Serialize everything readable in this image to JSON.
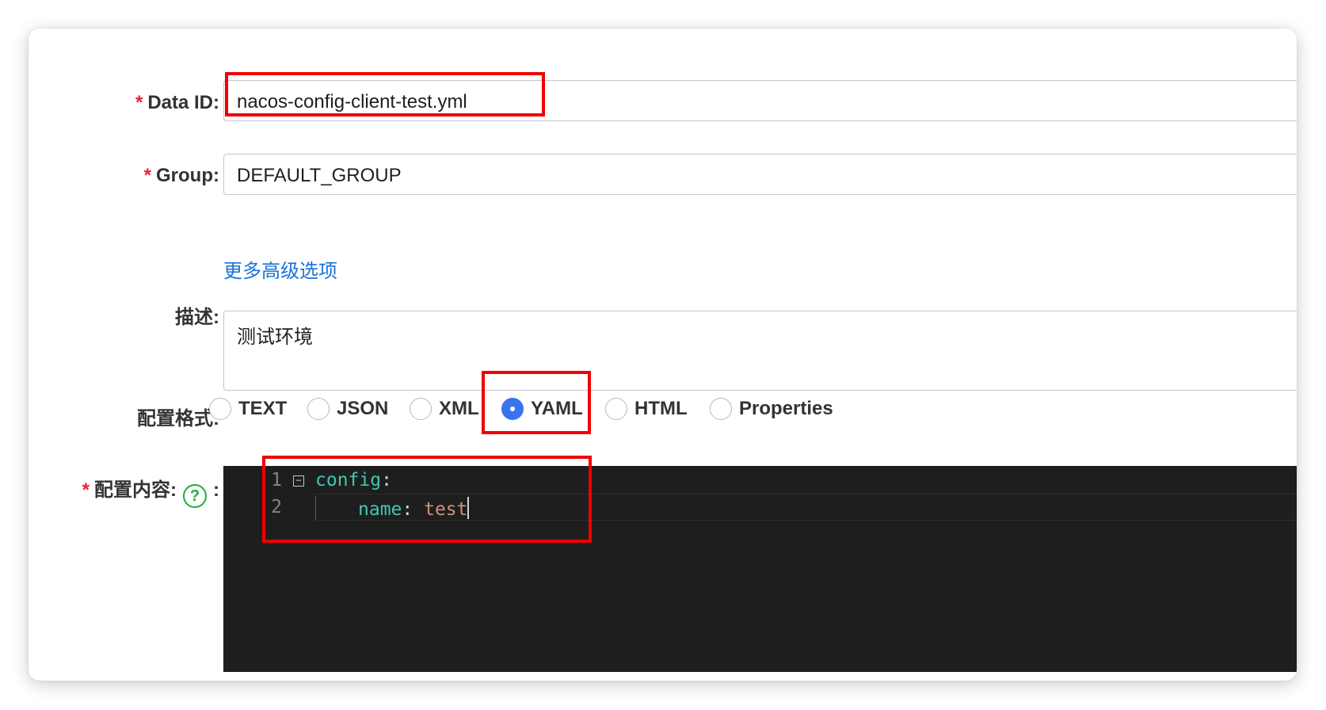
{
  "form": {
    "data_id": {
      "label": "Data ID:",
      "value": "nacos-config-client-test.yml"
    },
    "group": {
      "label": "Group:",
      "value": "DEFAULT_GROUP"
    },
    "advanced_link": "更多高级选项",
    "description": {
      "label": "描述:",
      "value": "测试环境"
    },
    "format": {
      "label": "配置格式:",
      "options": [
        "TEXT",
        "JSON",
        "XML",
        "YAML",
        "HTML",
        "Properties"
      ],
      "selected": "YAML"
    },
    "content": {
      "label": "配置内容:",
      "help": "?",
      "colon": ":",
      "line_numbers": [
        "1",
        "2"
      ],
      "line1_key": "config",
      "line1_colon": ":",
      "line2_key": "name",
      "line2_colon": ": ",
      "line2_value": "test"
    },
    "required_marker": "*"
  },
  "colors": {
    "accent": "#3a73f0",
    "link": "#1a73d9",
    "required": "#e8232f",
    "highlight": "#f00000",
    "editor_bg": "#1e1e1e",
    "help_icon": "#1fae3a"
  }
}
